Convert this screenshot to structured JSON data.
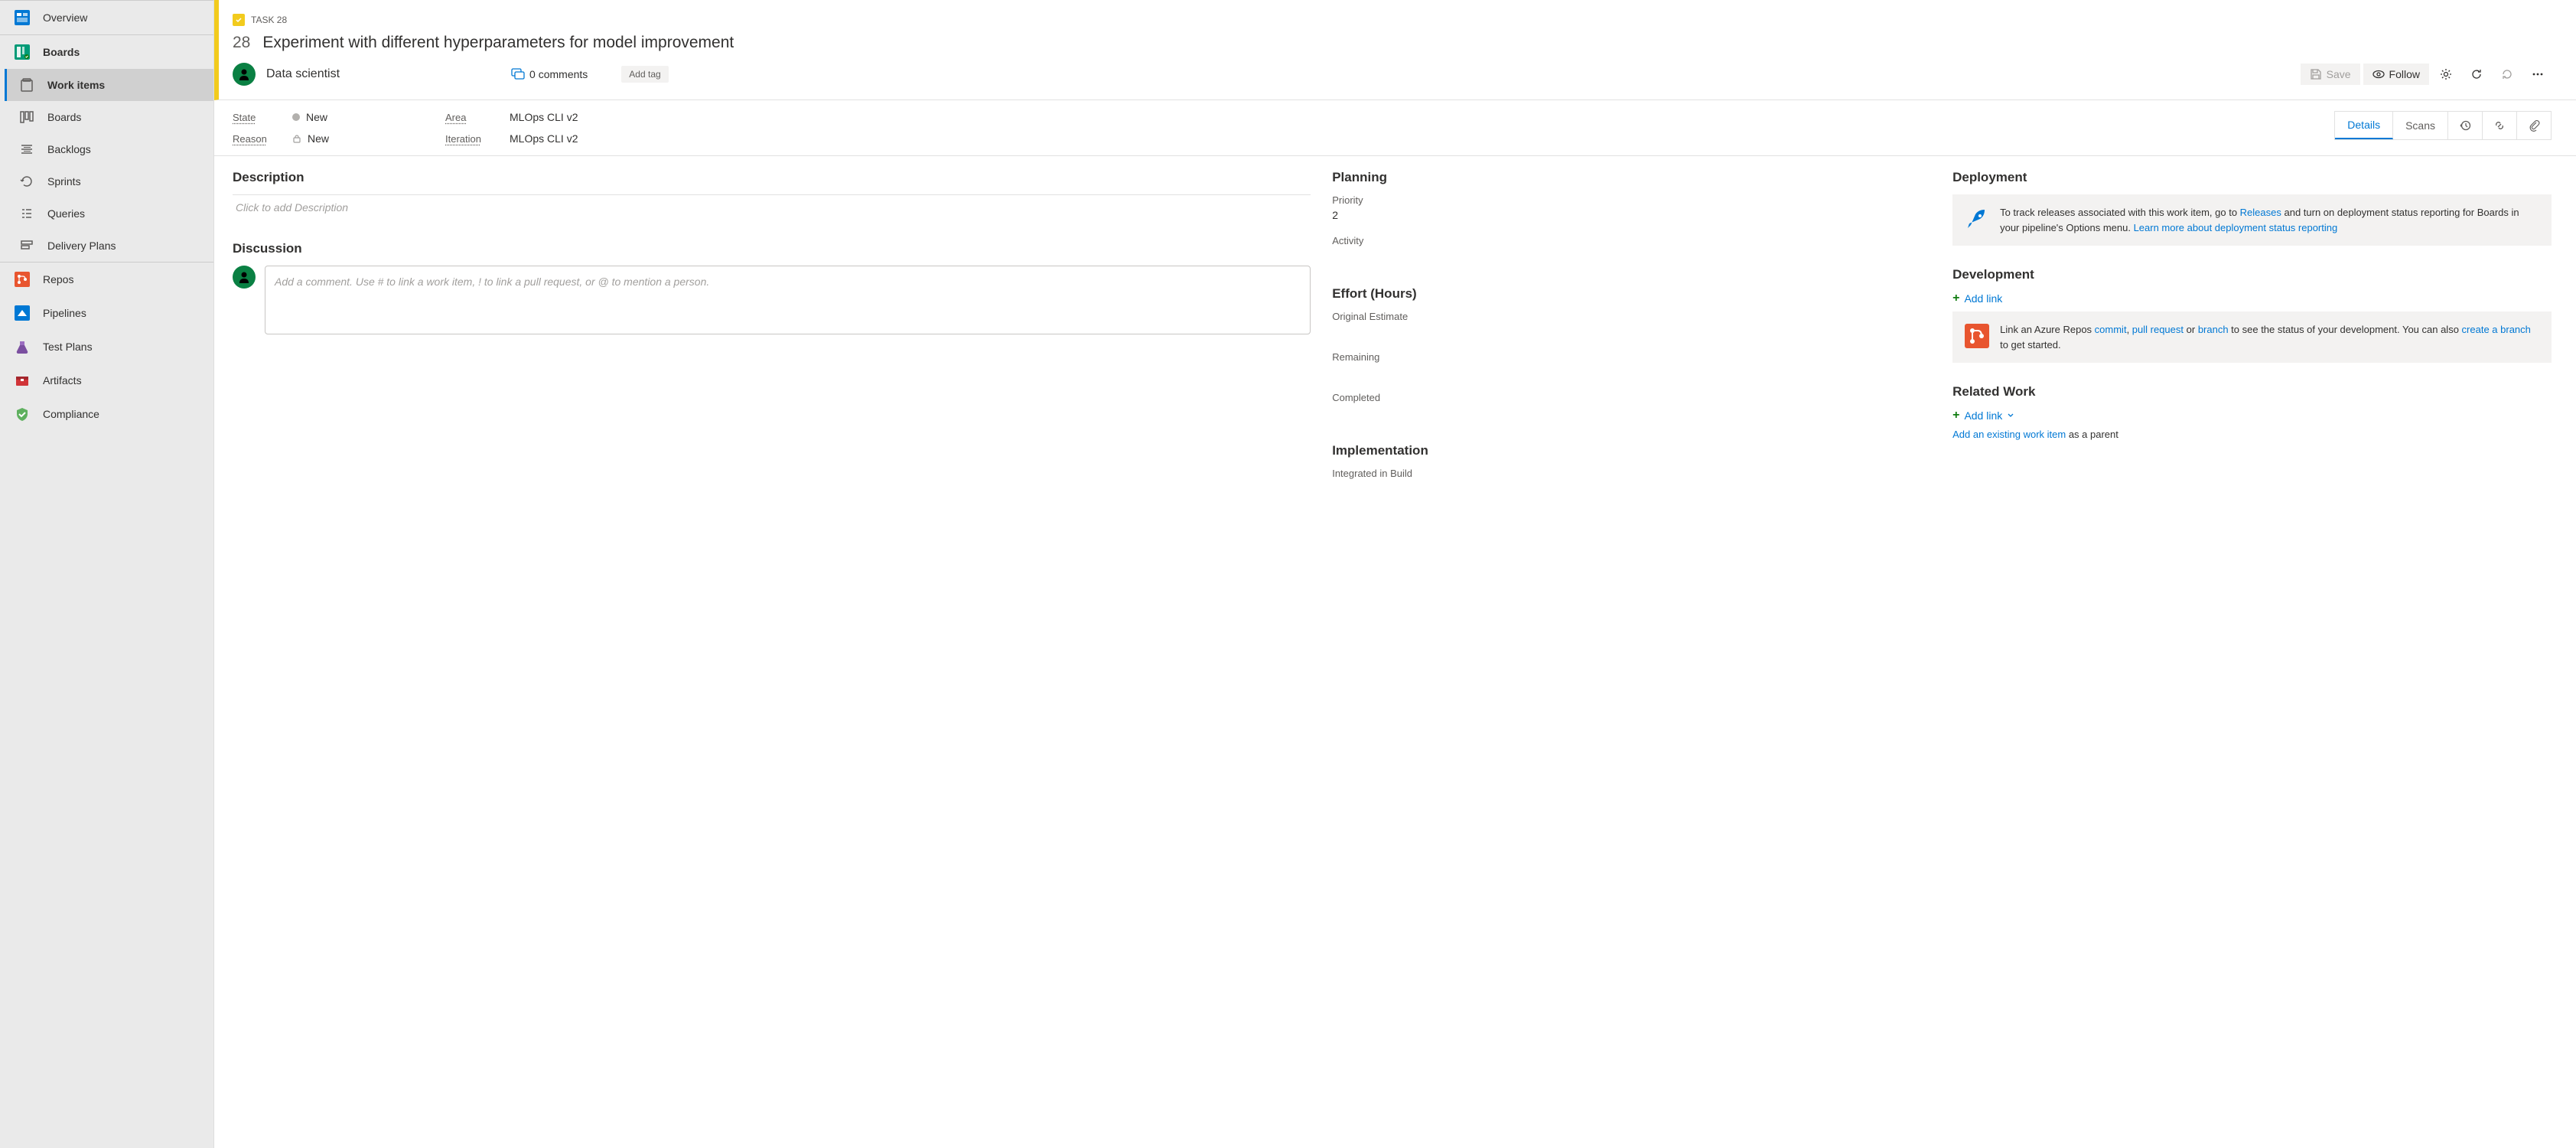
{
  "sidebar": {
    "top": [
      {
        "label": "Overview"
      },
      {
        "label": "Boards"
      }
    ],
    "boards_sub": [
      {
        "label": "Work items"
      },
      {
        "label": "Boards"
      },
      {
        "label": "Backlogs"
      },
      {
        "label": "Sprints"
      },
      {
        "label": "Queries"
      },
      {
        "label": "Delivery Plans"
      }
    ],
    "bottom": [
      {
        "label": "Repos"
      },
      {
        "label": "Pipelines"
      },
      {
        "label": "Test Plans"
      },
      {
        "label": "Artifacts"
      },
      {
        "label": "Compliance"
      }
    ]
  },
  "workitem": {
    "type_label": "TASK 28",
    "id": "28",
    "title": "Experiment with different hyperparameters for model improvement",
    "assignee": "Data scientist",
    "comments_label": "0 comments",
    "add_tag_label": "Add tag",
    "toolbar": {
      "save": "Save",
      "follow": "Follow"
    },
    "classification": {
      "state_label": "State",
      "state_value": "New",
      "reason_label": "Reason",
      "reason_value": "New",
      "area_label": "Area",
      "area_value": "MLOps CLI v2",
      "iteration_label": "Iteration",
      "iteration_value": "MLOps CLI v2"
    },
    "tabs": {
      "details": "Details",
      "scans": "Scans"
    }
  },
  "body": {
    "description": {
      "title": "Description",
      "placeholder": "Click to add Description"
    },
    "discussion": {
      "title": "Discussion",
      "placeholder": "Add a comment. Use # to link a work item, ! to link a pull request, or @ to mention a person."
    },
    "planning": {
      "title": "Planning",
      "priority_label": "Priority",
      "priority_value": "2",
      "activity_label": "Activity"
    },
    "effort": {
      "title": "Effort (Hours)",
      "original_label": "Original Estimate",
      "remaining_label": "Remaining",
      "completed_label": "Completed"
    },
    "implementation": {
      "title": "Implementation",
      "integrated_label": "Integrated in Build"
    },
    "deployment": {
      "title": "Deployment",
      "text_pre": "To track releases associated with this work item, go to ",
      "releases_link": "Releases",
      "text_mid": " and turn on deployment status reporting for Boards in your pipeline's Options menu. ",
      "learn_link": "Learn more about deployment status reporting"
    },
    "development": {
      "title": "Development",
      "add_link": "Add link",
      "text_pre": "Link an Azure Repos ",
      "commit_link": "commit",
      "pr_link": "pull request",
      "branch_link": "branch",
      "text_mid": " to see the status of your development. You can also ",
      "create_link": "create a branch",
      "text_end": " to get started."
    },
    "related": {
      "title": "Related Work",
      "add_link": "Add link",
      "existing_link": "Add an existing work item",
      "parent_text": " as a parent"
    }
  }
}
